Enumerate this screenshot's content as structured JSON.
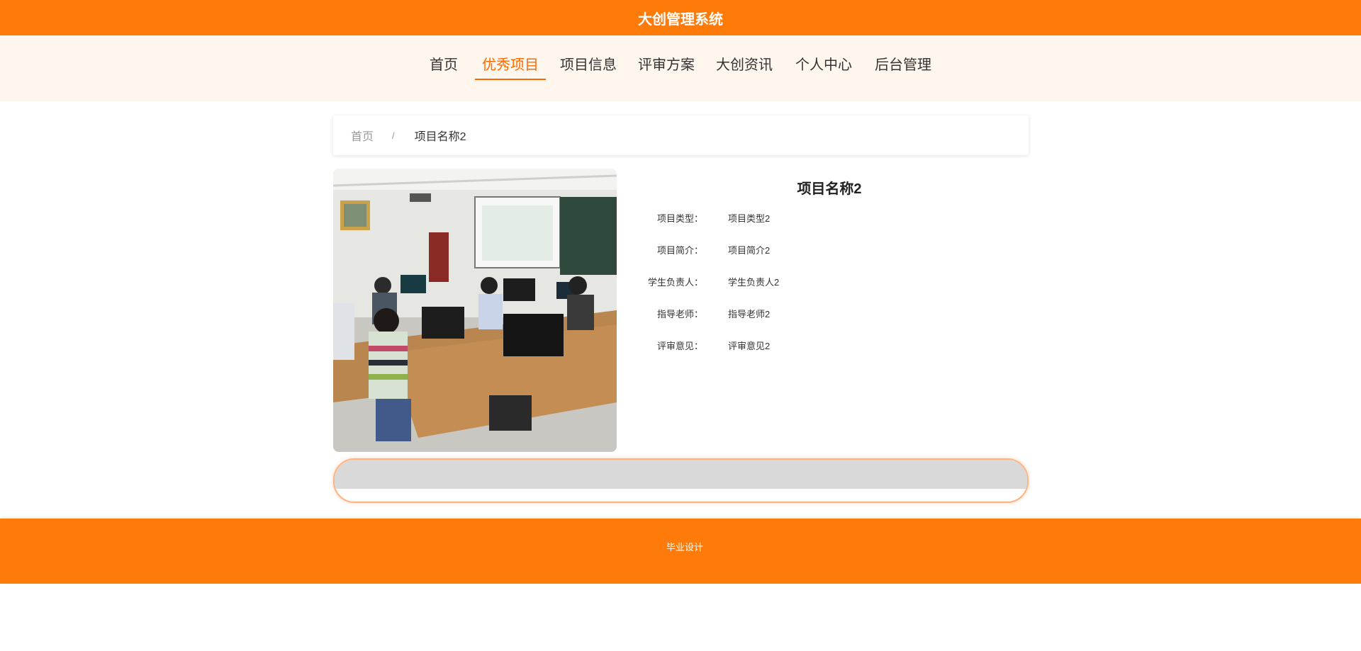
{
  "header": {
    "title": "大创管理系统"
  },
  "nav": {
    "items": [
      {
        "label": "首页",
        "active": false
      },
      {
        "label": "优秀项目",
        "active": true
      },
      {
        "label": "项目信息",
        "active": false
      },
      {
        "label": "评审方案",
        "active": false
      },
      {
        "label": "大创资讯",
        "active": false
      },
      {
        "label": "个人中心",
        "active": false
      },
      {
        "label": "后台管理",
        "active": false
      }
    ]
  },
  "breadcrumb": {
    "home": "首页",
    "separator": "/",
    "current": "项目名称2"
  },
  "detail": {
    "title": "项目名称2",
    "fields": [
      {
        "label": "项目类型：",
        "value": "项目类型2"
      },
      {
        "label": "项目简介：",
        "value": "项目简介2"
      },
      {
        "label": "学生负责人：",
        "value": "学生负责人2"
      },
      {
        "label": "指导老师：",
        "value": "指导老师2"
      },
      {
        "label": "评审意见：",
        "value": "评审意见2"
      }
    ]
  },
  "footer": {
    "text": "毕业设计"
  },
  "colors": {
    "brand": "#ff7b09",
    "active_nav": "#ff6a00",
    "nav_bg": "#fff6ee"
  }
}
